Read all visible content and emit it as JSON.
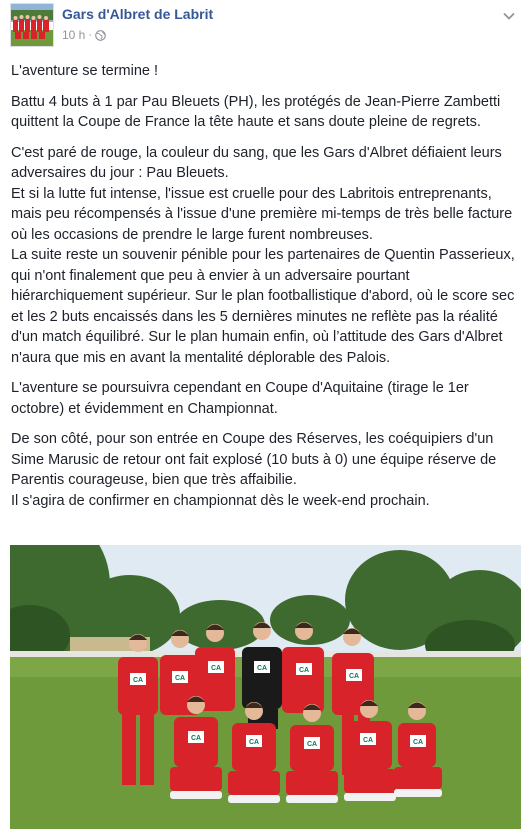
{
  "post": {
    "page_name": "Gars d'Albret de Labrit",
    "timestamp": "10 h",
    "separator": "·",
    "privacy_icon": "globe-icon",
    "menu_icon": "chevron-down-icon",
    "paragraphs": [
      "L'aventure se termine !",
      "Battu 4 buts à 1 par Pau Bleuets (PH), les protégés de Jean-Pierre Zambetti quittent la Coupe de France la tête haute et sans doute pleine de regrets.",
      "C'est paré de rouge, la couleur du sang, que les Gars d'Albret défiaient leurs adversaires du jour : Pau Bleuets.\nEt si la lutte fut intense, l'issue est cruelle pour des Labritois entreprenants, mais peu récompensés à l'issue d'une première mi-temps de très belle facture où les occasions de prendre le large furent nombreuses.\nLa suite reste un souvenir pénible pour les partenaires de Quentin Passerieux, qui n'ont finalement que peu à envier à un adversaire pourtant hiérarchiquement supérieur. Sur le plan footballistique d'abord, où le score sec et les 2 buts encaissés dans les 5 dernières minutes ne reflète pas la réalité d'un match équilibré. Sur le plan humain enfin, où l’attitude des Gars d'Albret n'aura que mis en avant la mentalité déplorable des Palois.",
      "L'aventure se poursuivra cependant en Coupe d'Aquitaine (tirage le 1er octobre) et évidemment en Championnat.",
      "De son côté, pour son entrée en Coupe des Réserves, les coéquipiers d'un Sime Marusic de retour ont fait explosé (10 buts à 0) une équipe réserve de Parentis courageuse, bien que très affaibilie.\nIl s'agira de confirmer en championnat dès le week-end prochain."
    ],
    "jersey_text": "CA",
    "colors": {
      "link": "#365899",
      "meta": "#90949c",
      "text": "#1d2129",
      "jersey_red": "#d8232a",
      "grass": "#6f9a3c",
      "sky": "#dfeaf3"
    }
  }
}
